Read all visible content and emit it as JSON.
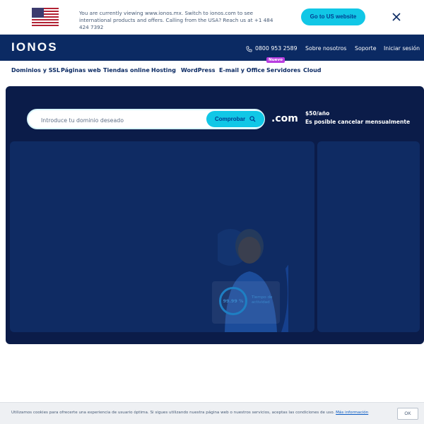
{
  "banner": {
    "message": "You are currently viewing www.ionos.mx. Switch to ionos.com to see international products and offers. Calling from the USA? Reach us at +1 484 424 7392",
    "button_label": "Go to US website",
    "flag_icon": "us-flag-icon",
    "close_icon": "close-icon"
  },
  "header": {
    "logo": "IONOS",
    "phone": "0800 953 2589",
    "phone_icon": "phone-icon",
    "links": [
      "Sobre nosotros",
      "Soporte",
      "Iniciar sesión"
    ]
  },
  "menu": {
    "items": [
      "Dominios y SSL",
      "Páginas web",
      "Tiendas online",
      "Hosting",
      "WordPress",
      "E-mail y Office",
      "Servidores",
      "Cloud"
    ],
    "new_badge": "Nuevo"
  },
  "hero": {
    "search_placeholder": "Introduce tu dominio deseado",
    "search_button": "Comprobar",
    "tld": ".com",
    "price": "$50/año",
    "cancel_note": "Es posible cancelar mensualmente",
    "uptime_value": "99.99 %",
    "uptime_label": "Tiempo de actividad"
  },
  "cookie": {
    "text": "Utilizamos cookies para ofrecerte una experiencia de usuario óptima. Si sigues utilizando nuestra página web o nuestros servicios, aceptas las condiciones de uso.",
    "link": "Más información",
    "button": "OK"
  },
  "colors": {
    "brand_navy": "#0b2a63",
    "accent_cyan": "#11c7e6",
    "hero_bg": "#0b1c49",
    "badge_purple": "#b93ee0"
  }
}
